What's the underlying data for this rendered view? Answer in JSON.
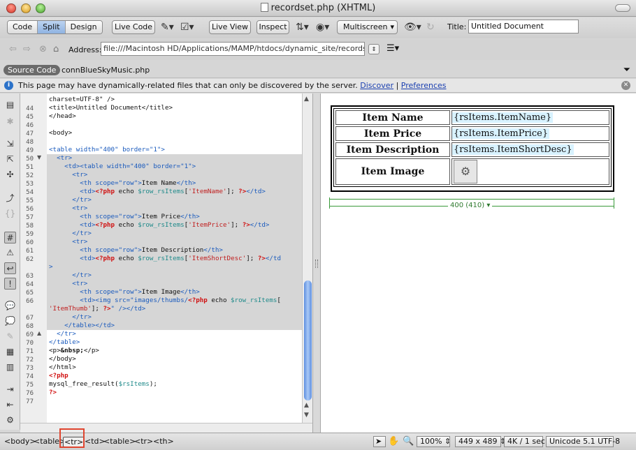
{
  "window": {
    "title": "recordset.php (XHTML)"
  },
  "toolbar": {
    "code_label": "Code",
    "split_label": "Split",
    "design_label": "Design",
    "live_code_label": "Live Code",
    "live_view_label": "Live View",
    "inspect_label": "Inspect",
    "multiscreen_label": "Multiscreen",
    "title_label": "Title:",
    "title_value": "Untitled Document"
  },
  "address": {
    "label": "Address:",
    "value": "file:///Macintosh HD/Applications/MAMP/htdocs/dynamic_site/recordset.php"
  },
  "related": {
    "source_label": "Source Code",
    "file": "connBlueSkyMusic.php"
  },
  "infobar": {
    "message": "This page may have dynamically-related files that can only be discovered by the server.",
    "discover_link": "Discover",
    "preferences_link": "Preferences"
  },
  "code": {
    "line_numbers": [
      "44",
      "45",
      "46",
      "47",
      "48",
      "49",
      "50",
      "51",
      "52",
      "53",
      "54",
      "55",
      "56",
      "57",
      "58",
      "59",
      "60",
      "61",
      "62",
      "",
      "63",
      "64",
      "65",
      "66",
      "",
      "67",
      "68",
      "69",
      "70",
      "71",
      "72",
      "73",
      "74",
      "75",
      "76",
      "77"
    ],
    "first_line": "charset=UTF-8\" />"
  },
  "design": {
    "rows": [
      {
        "label": "Item Name",
        "value": "{rsItems.ItemName}"
      },
      {
        "label": "Item Price",
        "value": "{rsItems.ItemPrice}"
      },
      {
        "label": "Item Description",
        "value": "{rsItems.ItemShortDesc}"
      },
      {
        "label": "Item Image",
        "value": ""
      }
    ],
    "width_label": "400 (410) ▾"
  },
  "status": {
    "crumbs": [
      "<body>",
      "<table>",
      "<tr>",
      "<td>",
      "<table>",
      "<tr>",
      "<th>"
    ],
    "zoom": "100%",
    "dimensions": "449 x 489 ⇕",
    "size": "4K / 1 sec",
    "encoding": "Unicode 5.1 UTF-8"
  }
}
